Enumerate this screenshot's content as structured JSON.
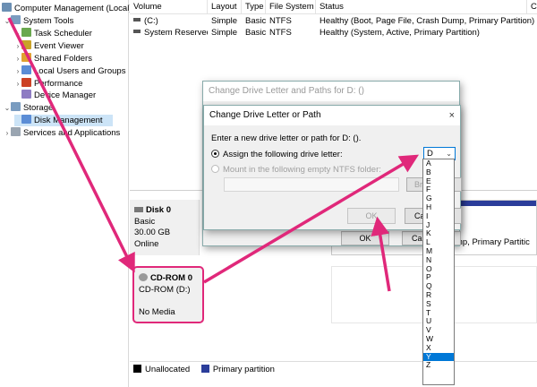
{
  "tree": {
    "root": "Computer Management (Local)",
    "items": [
      {
        "label": "System Tools",
        "icon": "system-tools-icon",
        "indent": 1,
        "twisty": "v",
        "selected": false
      },
      {
        "label": "Task Scheduler",
        "icon": "task-scheduler-icon",
        "indent": 2,
        "twisty": ">",
        "selected": false
      },
      {
        "label": "Event Viewer",
        "icon": "event-viewer-icon",
        "indent": 2,
        "twisty": ">",
        "selected": false
      },
      {
        "label": "Shared Folders",
        "icon": "shared-folders-icon",
        "indent": 2,
        "twisty": ">",
        "selected": false
      },
      {
        "label": "Local Users and Groups",
        "icon": "users-icon",
        "indent": 2,
        "twisty": ">",
        "selected": false
      },
      {
        "label": "Performance",
        "icon": "performance-icon",
        "indent": 2,
        "twisty": ">",
        "selected": false
      },
      {
        "label": "Device Manager",
        "icon": "device-manager-icon",
        "indent": 2,
        "twisty": "",
        "selected": false
      },
      {
        "label": "Storage",
        "icon": "storage-icon",
        "indent": 1,
        "twisty": "v",
        "selected": false
      },
      {
        "label": "Disk Management",
        "icon": "disk-management-icon",
        "indent": 2,
        "twisty": "",
        "selected": true
      },
      {
        "label": "Services and Applications",
        "icon": "services-icon",
        "indent": 1,
        "twisty": ">",
        "selected": false
      }
    ]
  },
  "volumes": {
    "columns": [
      "Volume",
      "Layout",
      "Type",
      "File System",
      "Status",
      "C"
    ],
    "rows": [
      {
        "volume": "(C:)",
        "layout": "Simple",
        "type": "Basic",
        "fs": "NTFS",
        "status": "Healthy (Boot, Page File, Crash Dump, Primary Partition)"
      },
      {
        "volume": "System Reserved",
        "layout": "Simple",
        "type": "Basic",
        "fs": "NTFS",
        "status": "Healthy (System, Active, Primary Partition)"
      }
    ]
  },
  "disks": {
    "disk0": {
      "name": "Disk 0",
      "type": "Basic",
      "size": "30.00 GB",
      "state": "Online",
      "partition_status": "mp, Primary Partitic"
    },
    "cdrom0": {
      "name": "CD-ROM 0",
      "drive": "CD-ROM (D:)",
      "media": "No Media"
    }
  },
  "legend": {
    "unallocated": "Unallocated",
    "primary": "Primary partition",
    "unallocated_color": "#000000",
    "primary_color": "#2b3d9a"
  },
  "dialog_back": {
    "title": "Change Drive Letter and Paths for D: ()",
    "ok": "OK",
    "cancel_partial": "Ca"
  },
  "dialog_front": {
    "title": "Change Drive Letter or Path",
    "close": "×",
    "prompt": "Enter a new drive letter or path for D: ().",
    "assign_label": "Assign the following drive letter:",
    "mount_label": "Mount in the following empty NTFS folder:",
    "browse_partial": "Bro",
    "ok": "OK",
    "cancel_partial": "Ca",
    "selected_letter": "D"
  },
  "dropdown": {
    "options": [
      "B",
      "E",
      "F",
      "G",
      "H",
      "I",
      "J",
      "K",
      "L",
      "M",
      "N",
      "O",
      "P",
      "Q",
      "R",
      "S",
      "T",
      "U",
      "V",
      "W",
      "X",
      "Y",
      "Z"
    ],
    "first": "A",
    "highlighted": "Y"
  },
  "arrow_color": "#e0287a"
}
